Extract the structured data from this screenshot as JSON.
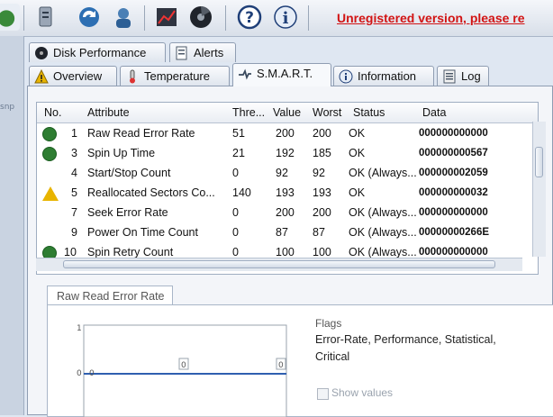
{
  "toolbar": {
    "unregistered_text": "Unregistered version, please re"
  },
  "left_strip": {
    "label": "snp"
  },
  "tabs_row1": [
    {
      "label": "Disk Performance"
    },
    {
      "label": "Alerts"
    }
  ],
  "tabs_row2": [
    {
      "label": "Overview"
    },
    {
      "label": "Temperature"
    },
    {
      "label": "S.M.A.R.T."
    },
    {
      "label": "Information"
    },
    {
      "label": "Log"
    }
  ],
  "grid": {
    "columns": {
      "no": "No.",
      "attribute": "Attribute",
      "threshold": "Thre...",
      "value": "Value",
      "worst": "Worst",
      "status": "Status",
      "data": "Data"
    },
    "rows": [
      {
        "no": "1",
        "attribute": "Raw Read Error Rate",
        "threshold": "51",
        "value": "200",
        "worst": "200",
        "status": "OK",
        "data": "000000000000",
        "icon": "ok"
      },
      {
        "no": "3",
        "attribute": "Spin Up Time",
        "threshold": "21",
        "value": "192",
        "worst": "185",
        "status": "OK",
        "data": "000000000567",
        "icon": "ok"
      },
      {
        "no": "4",
        "attribute": "Start/Stop Count",
        "threshold": "0",
        "value": "92",
        "worst": "92",
        "status": "OK (Always...",
        "data": "000000002059",
        "icon": "none"
      },
      {
        "no": "5",
        "attribute": "Reallocated Sectors Co...",
        "threshold": "140",
        "value": "193",
        "worst": "193",
        "status": "OK",
        "data": "000000000032",
        "icon": "warning"
      },
      {
        "no": "7",
        "attribute": "Seek Error Rate",
        "threshold": "0",
        "value": "200",
        "worst": "200",
        "status": "OK (Always...",
        "data": "000000000000",
        "icon": "none"
      },
      {
        "no": "9",
        "attribute": "Power On Time Count",
        "threshold": "0",
        "value": "87",
        "worst": "87",
        "status": "OK (Always...",
        "data": "00000000266E",
        "icon": "none"
      },
      {
        "no": "10",
        "attribute": "Spin Retry Count",
        "threshold": "0",
        "value": "100",
        "worst": "100",
        "status": "OK (Always...",
        "data": "000000000000",
        "icon": "ok"
      }
    ]
  },
  "detail": {
    "tab_label": "Raw Read Error Rate",
    "flags_label": "Flags",
    "flags_value": "Error-Rate, Performance, Statistical, Critical",
    "show_values_label": "Show values",
    "graph_points": [
      "0",
      "0",
      "0"
    ],
    "graph_top_tick": "1",
    "graph_zero_tick": "0"
  },
  "colors": {
    "accent": "#d21414",
    "ok": "#2e7d32",
    "warning": "#e8b400"
  }
}
